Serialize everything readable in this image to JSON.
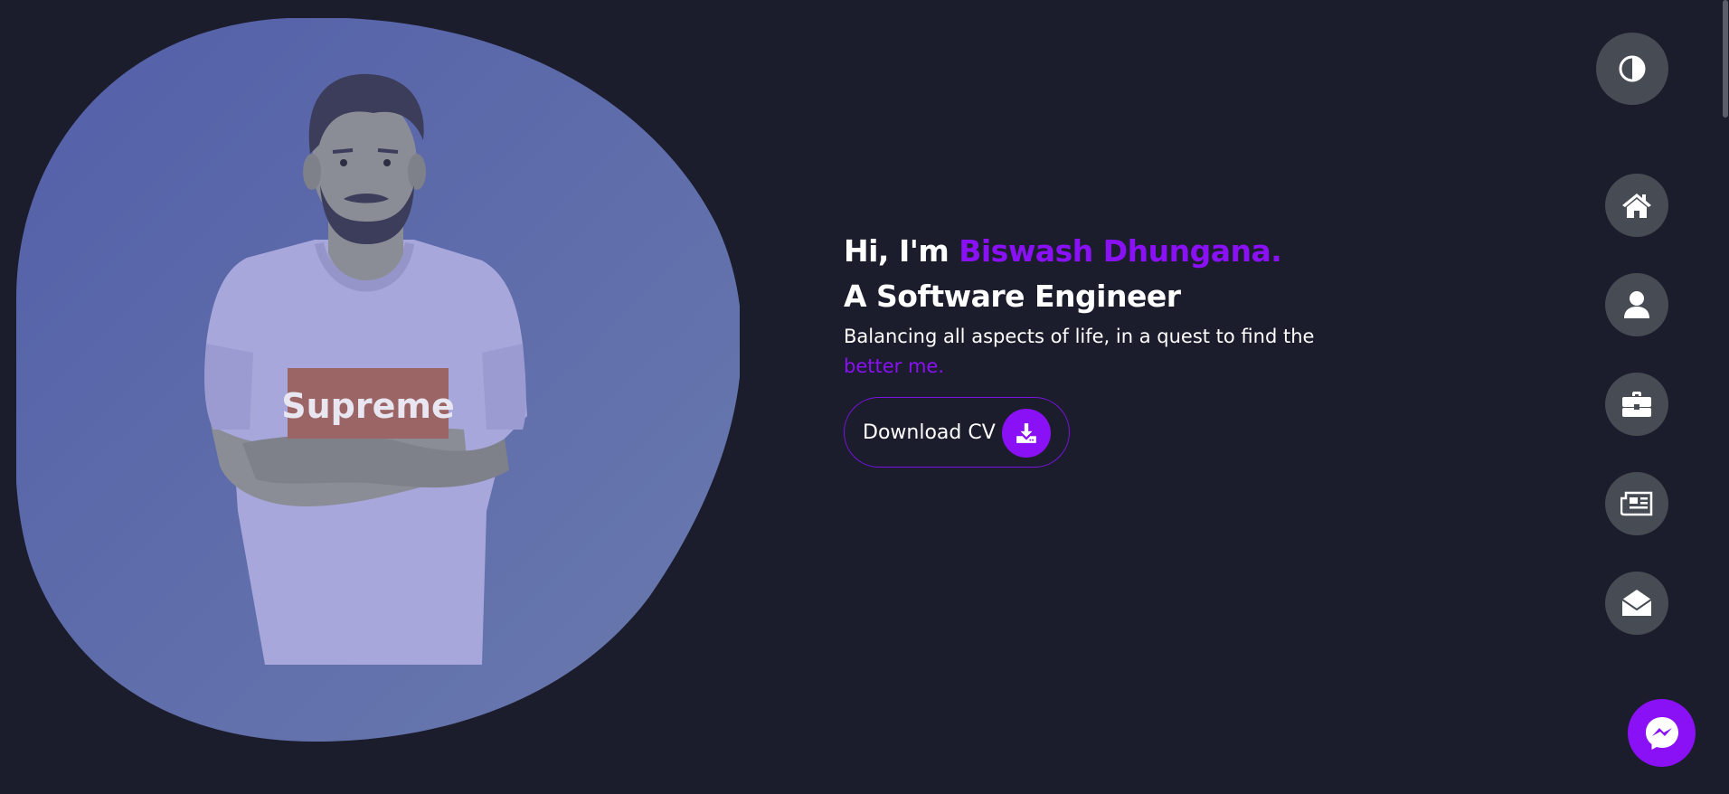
{
  "hero": {
    "greeting_prefix": "Hi, I'm ",
    "name": "Biswash Dhungana.",
    "role": "A Software Engineer",
    "tagline": "Balancing all aspects of life, in a quest to find the ",
    "tagline_highlight": "better me.",
    "cv_button_label": "Download CV",
    "illustration_text": "Supreme"
  },
  "nav": {
    "items": [
      {
        "icon": "home-icon"
      },
      {
        "icon": "user-icon"
      },
      {
        "icon": "briefcase-icon"
      },
      {
        "icon": "newspaper-icon"
      },
      {
        "icon": "envelope-open-icon"
      }
    ]
  },
  "controls": {
    "theme_toggle_icon": "half-circle-icon",
    "chat_icon": "messenger-icon"
  },
  "colors": {
    "background": "#1b1d2c",
    "accent": "#8a10f5",
    "button_bg": "#474b54",
    "blob": "#5e69ab"
  }
}
